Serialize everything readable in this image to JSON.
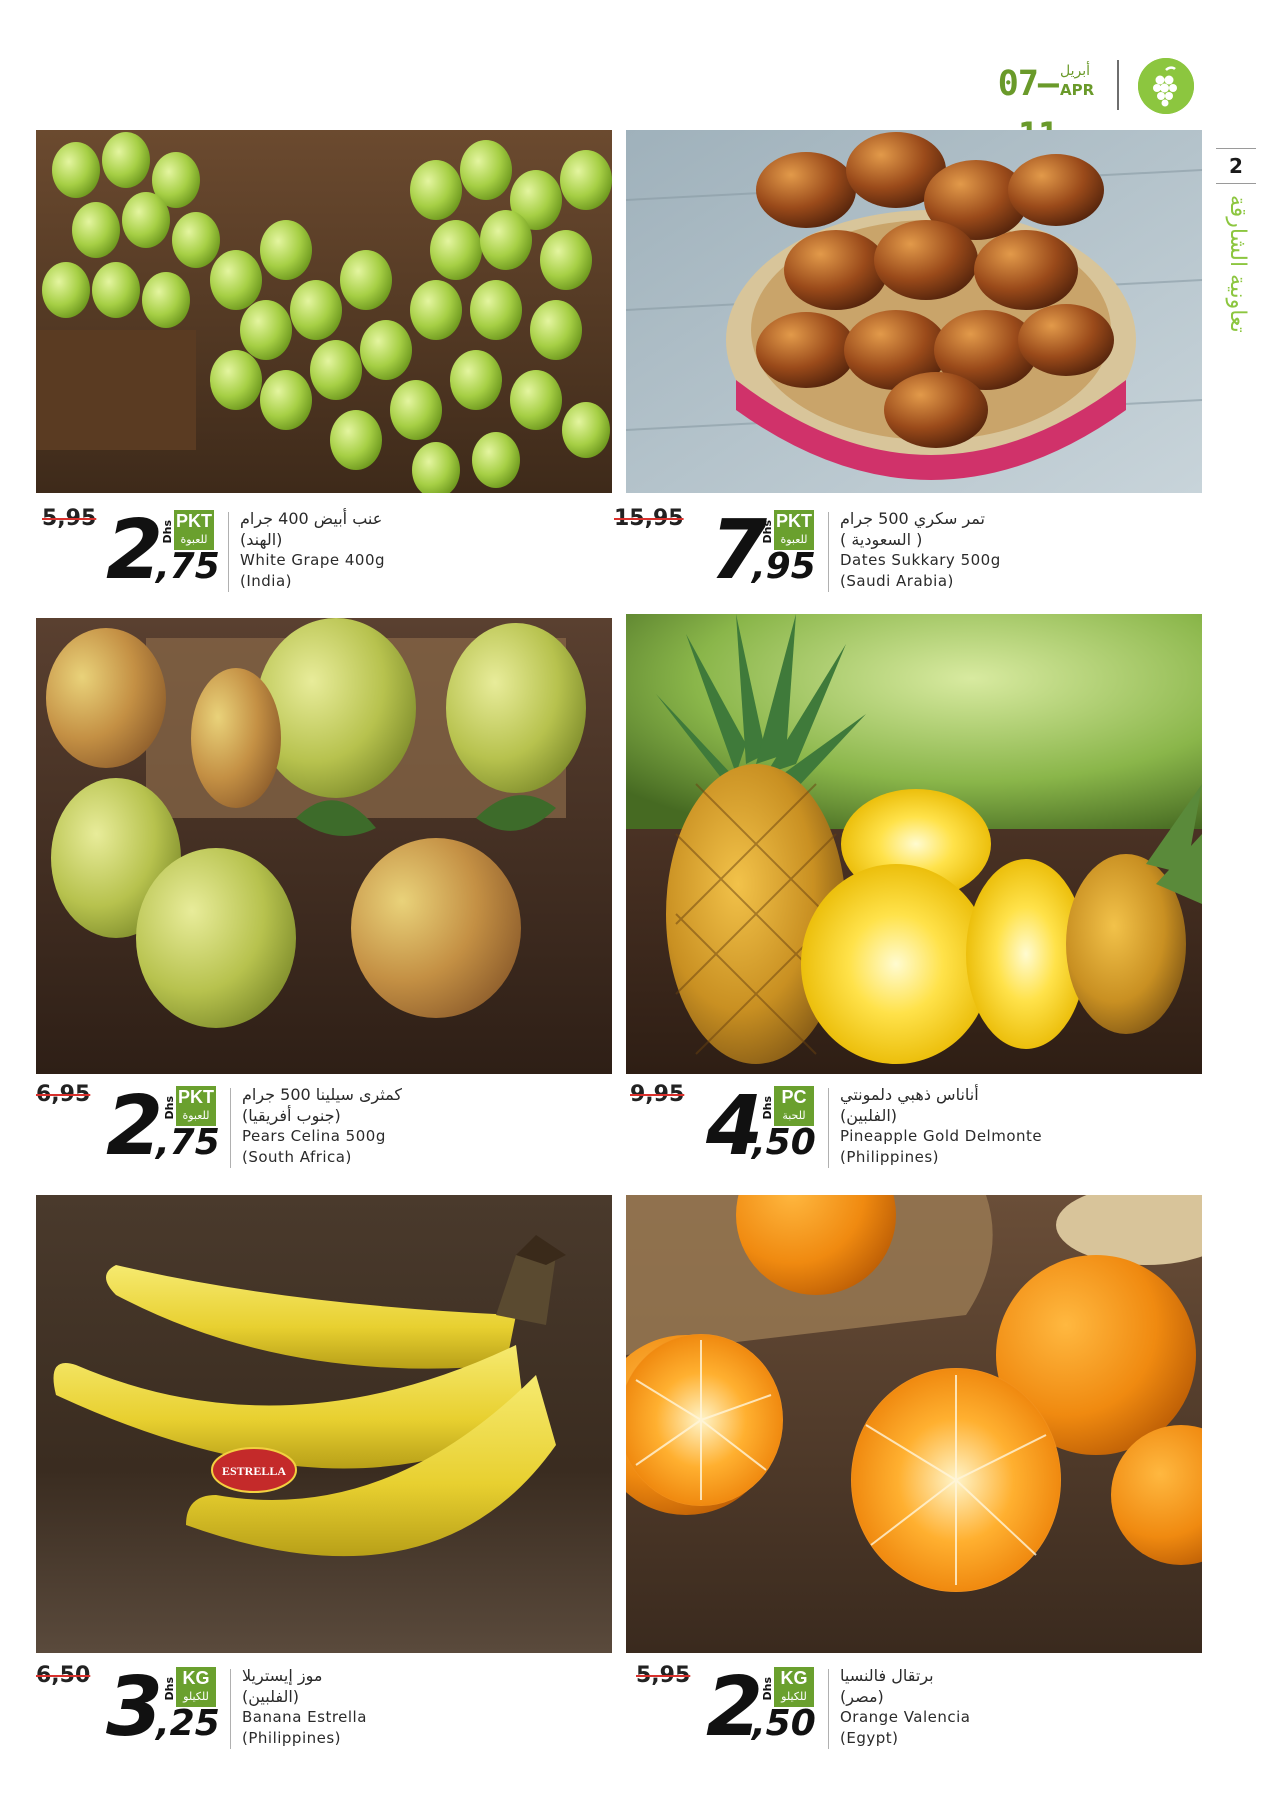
{
  "header": {
    "date_range": "07–11",
    "month_ar": "أبريل",
    "month_en": "APR",
    "logo_icon": "grapes-logo-icon"
  },
  "side": {
    "page_number": "2",
    "brand_ar": "تعاونية الشارقة"
  },
  "colors": {
    "brand_green": "#8cc63f",
    "unit_badge_green": "#6aa02e",
    "strike_red": "#d9302c"
  },
  "products": [
    {
      "id": "grape",
      "name_ar": "عنب أبيض 400 جرام",
      "origin_ar": "(الهند)",
      "name_en": "White Grape 400g",
      "origin_en": "(India)",
      "old_price": "5,95",
      "price_int": "2",
      "price_dec": ",75",
      "currency": "Dhs",
      "unit_en": "PKT",
      "unit_ar": "للعبوة"
    },
    {
      "id": "dates",
      "name_ar": "تمر سكري 500 جرام",
      "origin_ar": "( السعودية )",
      "name_en": "Dates Sukkary 500g",
      "origin_en": "(Saudi Arabia)",
      "old_price": "15,95",
      "price_int": "7",
      "price_dec": ",95",
      "currency": "Dhs",
      "unit_en": "PKT",
      "unit_ar": "للعبوة"
    },
    {
      "id": "pears",
      "name_ar": "كمثرى سيلينا 500 جرام",
      "origin_ar": "(جنوب أفريقيا)",
      "name_en": "Pears Celina 500g",
      "origin_en": "(South Africa)",
      "old_price": "6,95",
      "price_int": "2",
      "price_dec": ",75",
      "currency": "Dhs",
      "unit_en": "PKT",
      "unit_ar": "للعبوة"
    },
    {
      "id": "pineapple",
      "name_ar": "أناناس ذهبي دلمونتي",
      "origin_ar": "(الفلبين)",
      "name_en": "Pineapple Gold Delmonte",
      "origin_en": "(Philippines)",
      "old_price": "9,95",
      "price_int": "4",
      "price_dec": ",50",
      "currency": "Dhs",
      "unit_en": "PC",
      "unit_ar": "للحبة"
    },
    {
      "id": "banana",
      "name_ar": "موز إيستريلا",
      "origin_ar": "(الفلبين)",
      "name_en": "Banana Estrella",
      "origin_en": "(Philippines)",
      "old_price": "6,50",
      "price_int": "3",
      "price_dec": ",25",
      "currency": "Dhs",
      "unit_en": "KG",
      "unit_ar": "للكيلو",
      "sticker": "ESTRELLA"
    },
    {
      "id": "orange",
      "name_ar": "برتقال فالنسيا",
      "origin_ar": "(مصر)",
      "name_en": "Orange Valencia",
      "origin_en": "(Egypt)",
      "old_price": "5,95",
      "price_int": "2",
      "price_dec": ",50",
      "currency": "Dhs",
      "unit_en": "KG",
      "unit_ar": "للكيلو"
    }
  ]
}
